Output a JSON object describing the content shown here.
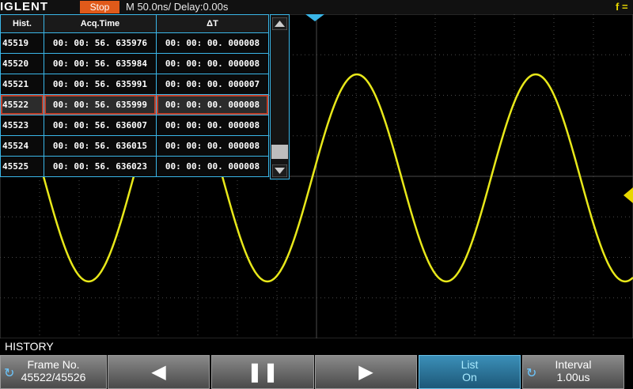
{
  "header": {
    "brand": "IGLENT",
    "run_status": "Stop",
    "timebase": "M 50.0ns/  Delay:0.00s",
    "freq_label": "f ="
  },
  "history_table": {
    "columns": [
      "Hist.",
      "Acq.Time",
      "ΔT"
    ],
    "rows": [
      {
        "hist": "45519",
        "acq_time": "00: 00: 56. 635976",
        "dt": "00: 00: 00. 000008"
      },
      {
        "hist": "45520",
        "acq_time": "00: 00: 56. 635984",
        "dt": "00: 00: 00. 000008"
      },
      {
        "hist": "45521",
        "acq_time": "00: 00: 56. 635991",
        "dt": "00: 00: 00. 000007"
      },
      {
        "hist": "45522",
        "acq_time": "00: 00: 56. 635999",
        "dt": "00: 00: 00. 000008"
      },
      {
        "hist": "45523",
        "acq_time": "00: 00: 56. 636007",
        "dt": "00: 00: 00. 000008"
      },
      {
        "hist": "45524",
        "acq_time": "00: 00: 56. 636015",
        "dt": "00: 00: 00. 000008"
      },
      {
        "hist": "45525",
        "acq_time": "00: 00: 56. 636023",
        "dt": "00: 00: 00. 000008"
      }
    ],
    "selected_hist": "45522"
  },
  "menu": {
    "title": "HISTORY",
    "frame_no_label": "Frame No.",
    "frame_no_value": "45522/45526",
    "prev_icon": "triangle-left-icon",
    "pause_icon": "pause-icon",
    "next_icon": "triangle-right-icon",
    "list_label": "List",
    "list_value": "On",
    "interval_label": "Interval",
    "interval_value": "1.00us"
  },
  "colors": {
    "trace": "#e8e81a",
    "accent": "#3ab6e8",
    "stop": "#e05a1a",
    "grid": "#4a4a4a"
  }
}
